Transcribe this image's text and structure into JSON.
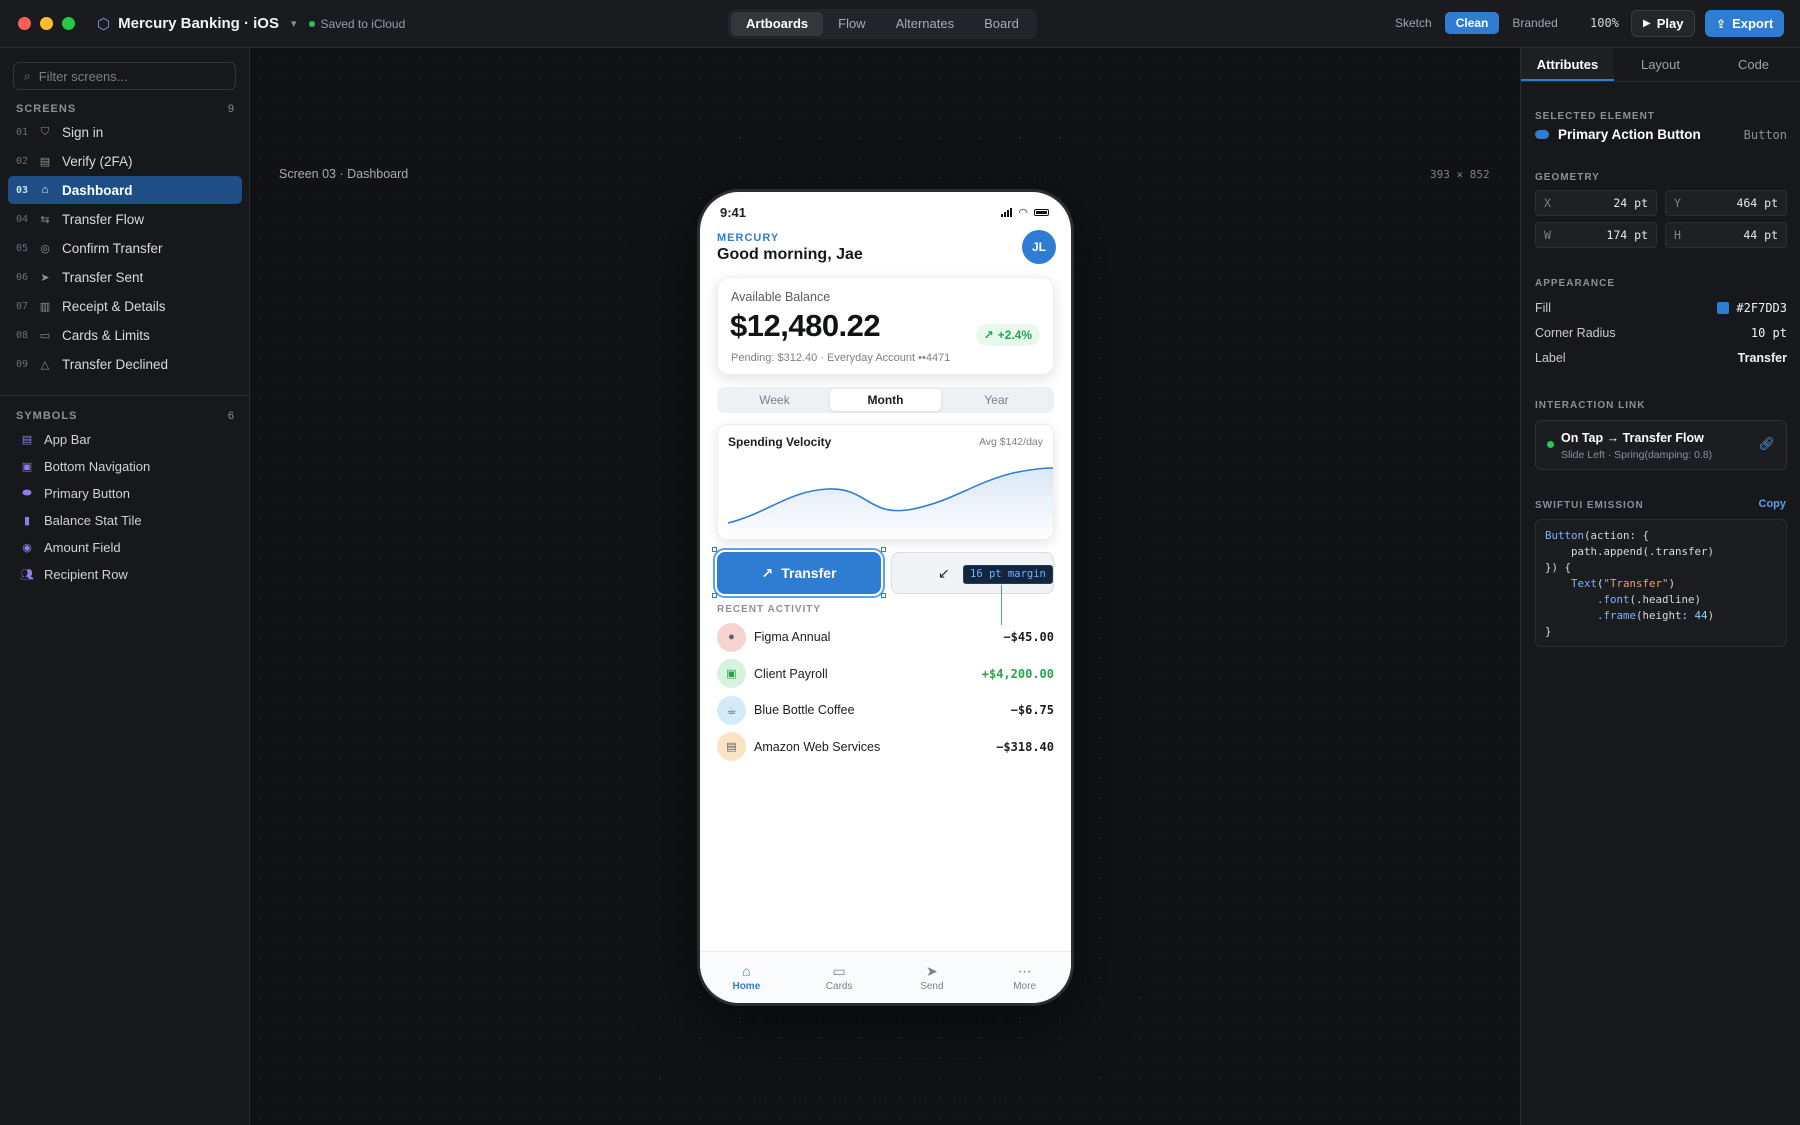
{
  "window": {
    "project_name": "Mercury Banking · iOS",
    "save_status": "Saved to iCloud"
  },
  "modes": [
    "Artboards",
    "Flow",
    "Alternates",
    "Board"
  ],
  "active_mode": "Artboards",
  "styles": [
    "Sketch",
    "Clean",
    "Branded"
  ],
  "active_style": "Clean",
  "zoom": "100%",
  "toolbar": {
    "play_label": "Play",
    "export_label": "Export"
  },
  "sidebar": {
    "filter_placeholder": "Filter screens...",
    "screens_title": "SCREENS",
    "screens_count": "9",
    "screens": [
      {
        "num": "01",
        "label": "Sign in",
        "icon": "shield-icon"
      },
      {
        "num": "02",
        "label": "Verify (2FA)",
        "icon": "code-icon"
      },
      {
        "num": "03",
        "label": "Dashboard",
        "icon": "home-icon"
      },
      {
        "num": "04",
        "label": "Transfer Flow",
        "icon": "swap-icon"
      },
      {
        "num": "05",
        "label": "Confirm Transfer",
        "icon": "check-circle-icon"
      },
      {
        "num": "06",
        "label": "Transfer Sent",
        "icon": "send-icon"
      },
      {
        "num": "07",
        "label": "Receipt & Details",
        "icon": "receipt-icon"
      },
      {
        "num": "08",
        "label": "Cards & Limits",
        "icon": "card-icon"
      },
      {
        "num": "09",
        "label": "Transfer Declined",
        "icon": "warning-icon"
      }
    ],
    "active_screen": "03",
    "symbols_title": "SYMBOLS",
    "symbols_count": "6",
    "symbols": [
      {
        "label": "App Bar",
        "icon": "app-bar-icon"
      },
      {
        "label": "Bottom Navigation",
        "icon": "bottom-nav-icon"
      },
      {
        "label": "Primary Button",
        "icon": "button-icon"
      },
      {
        "label": "Balance Stat Tile",
        "icon": "bar-chart-icon"
      },
      {
        "label": "Amount Field",
        "icon": "currency-icon"
      },
      {
        "label": "Recipient Row",
        "icon": "people-icon"
      }
    ]
  },
  "canvas": {
    "artboard_caption": "Screen 03 · Dashboard",
    "artboard_size": "393 × 852"
  },
  "phone": {
    "time": "9:41",
    "brand": "MERCURY",
    "greeting": "Good morning, Jae",
    "avatar_initials": "JL",
    "balance_label": "Available Balance",
    "balance_amount": "$12,480.22",
    "balance_change": "+2.4%",
    "balance_sub": "Pending: $312.40 · Everyday Account ••4471",
    "segments": [
      "Week",
      "Month",
      "Year"
    ],
    "active_segment": "Month",
    "chart_title": "Spending Velocity",
    "chart_avg": "Avg $142/day",
    "primary_action": "Transfer",
    "margin_annotation": "16 pt margin",
    "recent_title": "RECENT ACTIVITY",
    "transactions": [
      {
        "name": "Figma Annual",
        "amount": "−$45.00",
        "color": "#f6d3cf",
        "icon": "figma-icon",
        "positive": false
      },
      {
        "name": "Client Payroll",
        "amount": "+$4,200.00",
        "color": "#d7f3de",
        "icon": "briefcase-icon",
        "positive": true
      },
      {
        "name": "Blue Bottle Coffee",
        "amount": "−$6.75",
        "color": "#d4ecf8",
        "icon": "coffee-icon",
        "positive": false
      },
      {
        "name": "Amazon Web Services",
        "amount": "−$318.40",
        "color": "#fbe4c4",
        "icon": "server-icon",
        "positive": false
      }
    ],
    "tabs": [
      {
        "label": "Home",
        "icon": "home-icon"
      },
      {
        "label": "Cards",
        "icon": "card-icon"
      },
      {
        "label": "Send",
        "icon": "send-icon"
      },
      {
        "label": "More",
        "icon": "more-icon"
      }
    ],
    "active_tab": "Home"
  },
  "inspector": {
    "tabs": [
      "Attributes",
      "Layout",
      "Code"
    ],
    "active_tab": "Attributes",
    "selected_title": "SELECTED ELEMENT",
    "selected_name": "Primary Action Button",
    "selected_type": "Button",
    "geometry_title": "GEOMETRY",
    "geometry": {
      "x_label": "X",
      "x": "24 pt",
      "y_label": "Y",
      "y": "464 pt",
      "w_label": "W",
      "w": "174 pt",
      "h_label": "H",
      "h": "44 pt"
    },
    "appearance_title": "APPEARANCE",
    "fill_label": "Fill",
    "fill_value": "#2F7DD3",
    "radius_label": "Corner Radius",
    "radius_value": "10 pt",
    "text_label": "Label",
    "text_value": "Transfer",
    "interaction_title": "INTERACTION LINK",
    "interaction_main": "On Tap → Transfer Flow",
    "interaction_sub": "Slide Left · Spring(damping: 0.8)",
    "swift_title": "SWIFTUI EMISSION",
    "copy_label": "Copy",
    "code_lines": [
      "Button(action: {",
      "    path.append(.transfer)",
      "}) {",
      "    Text(\"Transfer\")",
      "        .font(.headline)",
      "        .frame(height: 44)",
      "}"
    ]
  },
  "colors": {
    "accent": "#2F7DD3",
    "positive": "#23A64A",
    "canvas": "#111215"
  }
}
